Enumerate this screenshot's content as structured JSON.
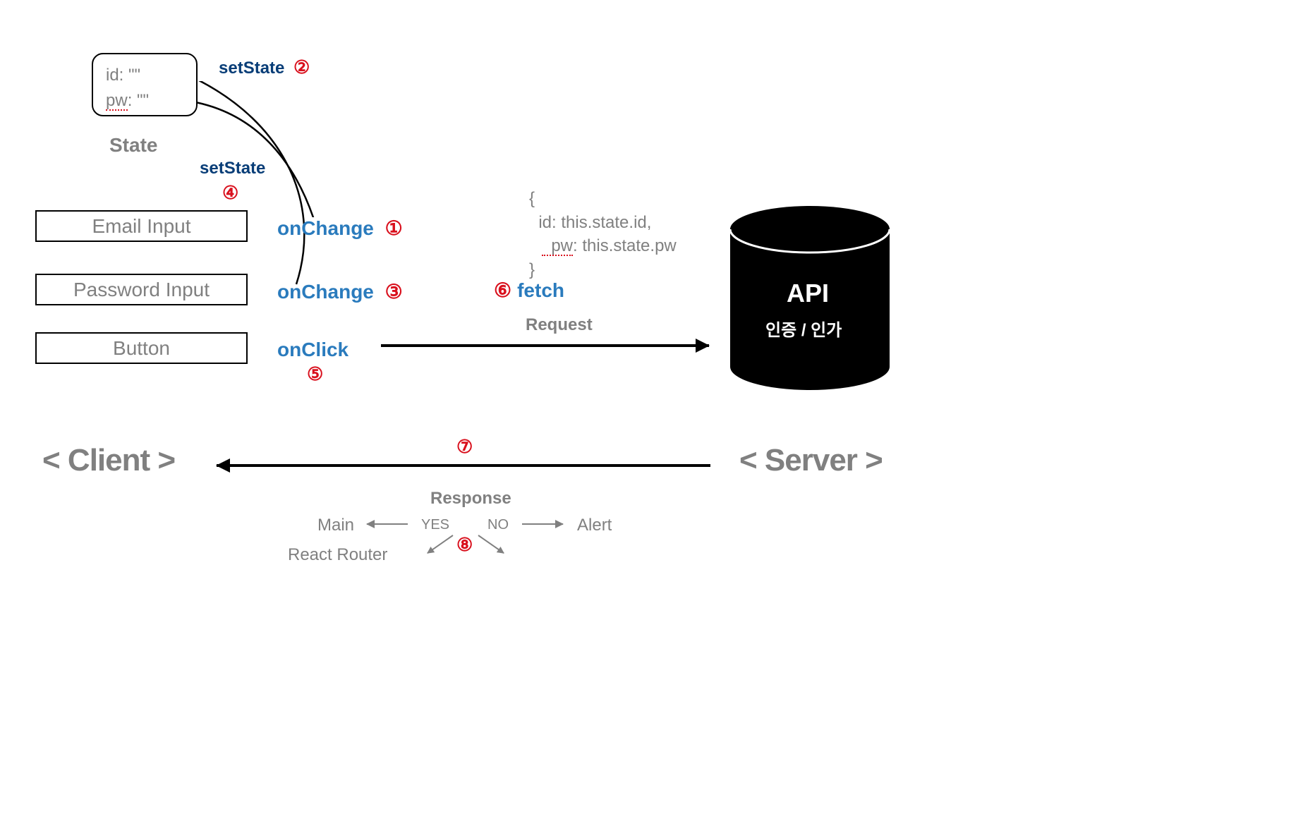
{
  "state": {
    "id_line": "id: \"\"",
    "pw_key": "pw",
    "pw_rest": ": \"\"",
    "label": "State"
  },
  "labels": {
    "setState2": "setState",
    "setState2_num": "②",
    "setState4": "setState",
    "setState4_num": "④",
    "onChange1": "onChange",
    "onChange1_num": "①",
    "onChange3": "onChange",
    "onChange3_num": "③",
    "onClick5": "onClick",
    "onClick5_num": "⑤",
    "fetch6": "fetch",
    "fetch6_num": "⑥",
    "request": "Request",
    "response": "Response",
    "resp7_num": "⑦",
    "yes": "YES",
    "no": "NO",
    "main": "Main",
    "alert": "Alert",
    "router": "React Router",
    "num8": "⑧",
    "client": "< Client >",
    "server": "< Server >"
  },
  "inputs": {
    "email": "Email Input",
    "password": "Password Input",
    "button": "Button"
  },
  "payload": {
    "open": "{",
    "l1": "  id: this.state.id,",
    "l2_key": "  pw",
    "l2_rest": ": this.state.pw",
    "close": "}"
  },
  "api": {
    "title": "API",
    "sub": "인증 / 인가"
  }
}
